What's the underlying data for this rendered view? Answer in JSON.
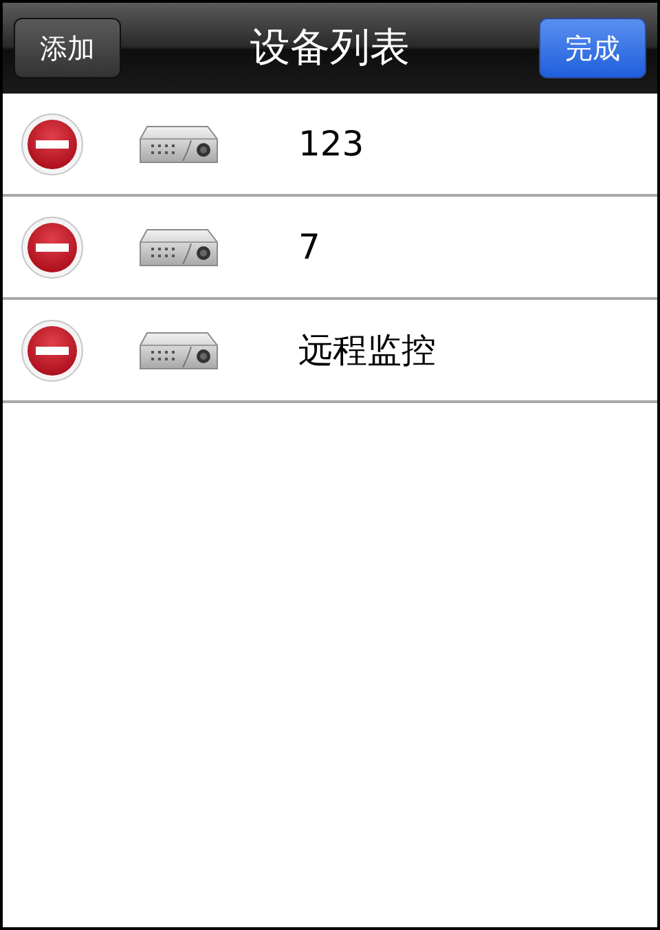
{
  "nav_bar": {
    "title": "设备列表",
    "left_button": "添加",
    "right_button": "完成"
  },
  "devices": [
    {
      "name": "123"
    },
    {
      "name": "7"
    },
    {
      "name": "远程监控"
    }
  ]
}
